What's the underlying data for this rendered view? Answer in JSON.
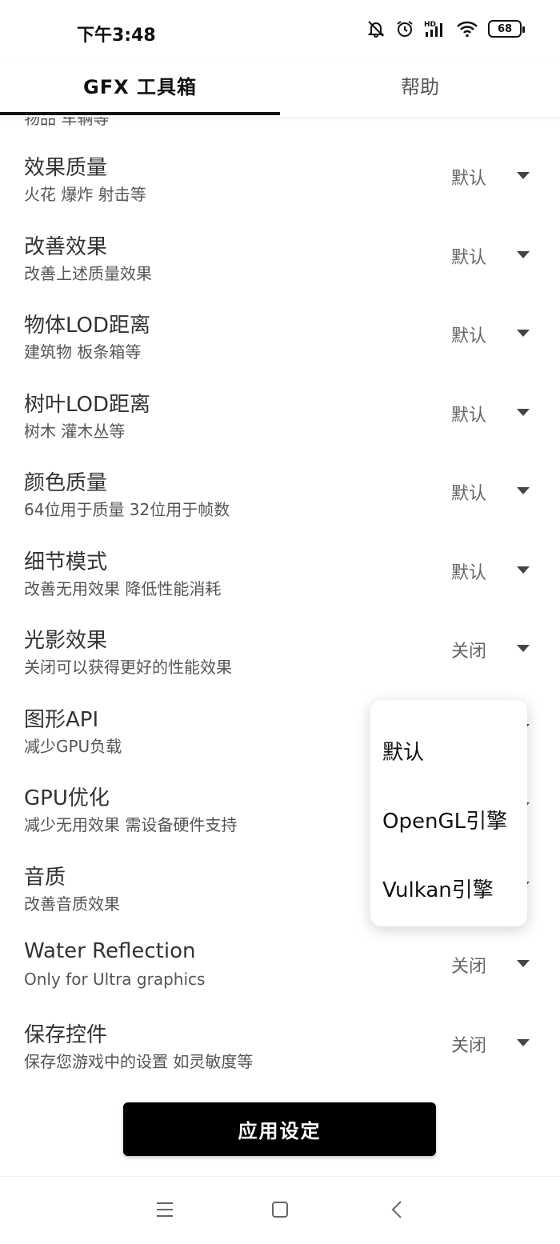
{
  "status_bar": {
    "time": "下午3:48",
    "battery": "68",
    "icons": [
      "mute-icon",
      "alarm-icon",
      "hd-signal-icon",
      "wifi-icon",
      "battery-icon"
    ]
  },
  "tabs": [
    {
      "label": "GFX 工具箱",
      "active": true
    },
    {
      "label": "帮助",
      "active": false
    }
  ],
  "partial_text": "物品 车辆等",
  "settings": [
    {
      "title": "效果质量",
      "subtitle": "火花 爆炸 射击等",
      "value": "默认"
    },
    {
      "title": "改善效果",
      "subtitle": "改善上述质量效果",
      "value": "默认"
    },
    {
      "title": "物体LOD距离",
      "subtitle": "建筑物 板条箱等",
      "value": "默认"
    },
    {
      "title": "树叶LOD距离",
      "subtitle": "树木 灌木丛等",
      "value": "默认"
    },
    {
      "title": "颜色质量",
      "subtitle": "64位用于质量 32位用于帧数",
      "value": "默认"
    },
    {
      "title": "细节模式",
      "subtitle": "改善无用效果 降低性能消耗",
      "value": "默认"
    },
    {
      "title": "光影效果",
      "subtitle": "关闭可以获得更好的性能效果",
      "value": "关闭"
    },
    {
      "title": "图形API",
      "subtitle": "减少GPU负载",
      "value": ""
    },
    {
      "title": "GPU优化",
      "subtitle": "减少无用效果 需设备硬件支持",
      "value": ""
    },
    {
      "title": "音质",
      "subtitle": "改善音质效果",
      "value": ""
    },
    {
      "title": "Water Reflection",
      "subtitle": "Only for Ultra graphics",
      "value": "关闭"
    },
    {
      "title": "保存控件",
      "subtitle": "保存您游戏中的设置 如灵敏度等",
      "value": "关闭"
    }
  ],
  "dropdown": {
    "options": [
      "默认",
      "OpenGL引擎",
      "Vulkan引擎"
    ]
  },
  "apply_button": "应用设定",
  "nav_bar": [
    "menu-icon",
    "home-icon",
    "back-icon"
  ]
}
